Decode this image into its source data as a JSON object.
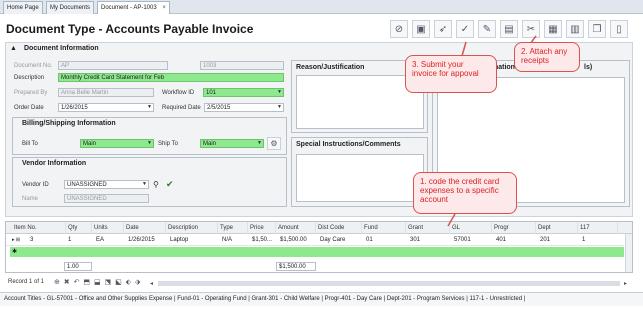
{
  "tabs": [
    {
      "label": "Home Page"
    },
    {
      "label": "My Documents"
    },
    {
      "label": "Document - AP-1003",
      "close": "×"
    }
  ],
  "title": "Document Type - Accounts Payable Invoice",
  "doc_info": {
    "heading": "Document Information",
    "document_no_label": "Document No.",
    "document_prefix": "AP",
    "document_number": "1003",
    "description_label": "Description",
    "description_value": "Monthly Credit Card Statement for Feb",
    "prepared_by_label": "Prepared By",
    "prepared_by_value": "Anna Belle Martin",
    "workflow_label": "Workflow ID",
    "workflow_value": "101",
    "order_date_label": "Order Date",
    "order_date_value": "1/26/2015",
    "required_date_label": "Required Date",
    "required_date_value": "2/5/2015"
  },
  "billing": {
    "heading": "Billing/Shipping Information",
    "bill_to_label": "Bill To",
    "bill_to_value": "Main",
    "ship_to_label": "Ship To",
    "ship_to_value": "Main"
  },
  "vendor": {
    "heading": "Vendor Information",
    "vendor_id_label": "Vendor ID",
    "vendor_id_value": "UNASSIGNED",
    "name_label": "Name",
    "name_value": "UNASSIGNED"
  },
  "reason": {
    "heading": "Reason/Justification"
  },
  "special": {
    "heading": "Special Instructions/Comments"
  },
  "right_panel": {
    "heading_fragment": "mation",
    "heading_tail": "ls)"
  },
  "grid": {
    "columns": [
      "Item No.",
      "Qty",
      "Units",
      "Date",
      "Description",
      "Type",
      "Price",
      "Amount",
      "Dist Code",
      "Fund",
      "Grant",
      "GL",
      "Progr",
      "Dept",
      "117"
    ],
    "row": [
      "3",
      "1",
      "EA",
      "1/26/2015",
      "Laptop",
      "N/A",
      "$1,50...",
      "$1,500.00",
      "Day Care",
      "01",
      "301",
      "57001",
      "401",
      "201",
      "1"
    ],
    "total_qty": "1.00",
    "total_amount": "$1,500.00",
    "record_text": "Record 1 of 1"
  },
  "status_bar": "Account Titles - GL-57001 - Office and Other Supplies Expense | Fund-01 - Operating Fund | Grant-301 - Child Welfare | Progr-401 - Day Care | Dept-201 - Program Services | 117-1 - Unrestricted |",
  "callouts": {
    "submit": "3. Submit your invoice for appoval",
    "attach": "2. Attach any receipts",
    "code": "1. code the credit card expenses to a specific account"
  },
  "colors": {
    "accent_green": "#8ee88e",
    "callout_border": "#d9534f",
    "callout_text": "#dd2222"
  }
}
